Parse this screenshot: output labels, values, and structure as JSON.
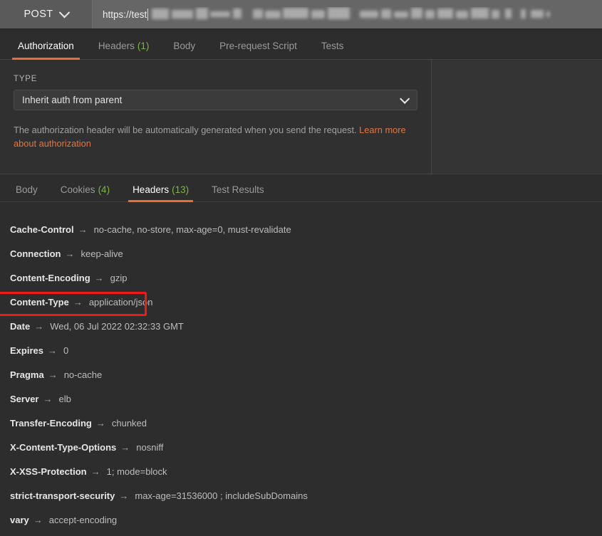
{
  "request_bar": {
    "method": "POST",
    "method_chevron_icon": "chevron-down-icon",
    "url_visible": "https://test",
    "url_redacted": true
  },
  "request_tabs": [
    {
      "label": "Authorization",
      "count": "",
      "active": true
    },
    {
      "label": "Headers",
      "count": "(1)",
      "active": false
    },
    {
      "label": "Body",
      "count": "",
      "active": false
    },
    {
      "label": "Pre-request Script",
      "count": "",
      "active": false
    },
    {
      "label": "Tests",
      "count": "",
      "active": false
    }
  ],
  "authorization": {
    "type_label": "TYPE",
    "selected_type": "Inherit auth from parent",
    "select_chevron_icon": "chevron-down-icon",
    "note_text": "The authorization header will be automatically generated when you send the request. ",
    "note_link": "Learn more about authorization"
  },
  "response_tabs": [
    {
      "label": "Body",
      "count": "",
      "active": false
    },
    {
      "label": "Cookies",
      "count": "(4)",
      "active": false
    },
    {
      "label": "Headers",
      "count": "(13)",
      "active": true
    },
    {
      "label": "Test Results",
      "count": "",
      "active": false
    }
  ],
  "response_headers": {
    "arrow": "→",
    "rows": [
      {
        "key": "Cache-Control",
        "value": "no-cache, no-store, max-age=0, must-revalidate",
        "highlighted": false
      },
      {
        "key": "Connection",
        "value": "keep-alive",
        "highlighted": false
      },
      {
        "key": "Content-Encoding",
        "value": "gzip",
        "highlighted": false
      },
      {
        "key": "Content-Type",
        "value": "application/json",
        "highlighted": true
      },
      {
        "key": "Date",
        "value": "Wed, 06 Jul 2022 02:32:33 GMT",
        "highlighted": false
      },
      {
        "key": "Expires",
        "value": "0",
        "highlighted": false
      },
      {
        "key": "Pragma",
        "value": "no-cache",
        "highlighted": false
      },
      {
        "key": "Server",
        "value": "elb",
        "highlighted": false
      },
      {
        "key": "Transfer-Encoding",
        "value": "chunked",
        "highlighted": false
      },
      {
        "key": "X-Content-Type-Options",
        "value": "nosniff",
        "highlighted": false
      },
      {
        "key": "X-XSS-Protection",
        "value": "1; mode=block",
        "highlighted": false
      },
      {
        "key": "strict-transport-security",
        "value": "max-age=31536000 ; includeSubDomains",
        "highlighted": false
      },
      {
        "key": "vary",
        "value": "accept-encoding",
        "highlighted": false
      }
    ]
  },
  "colors": {
    "accent_orange": "#ef6c2e",
    "count_green": "#78b93c",
    "annotation_red": "#f01818",
    "panel_bg": "#2d2d2d",
    "auth_bg": "#303030",
    "url_bar_bg": "#666666"
  }
}
